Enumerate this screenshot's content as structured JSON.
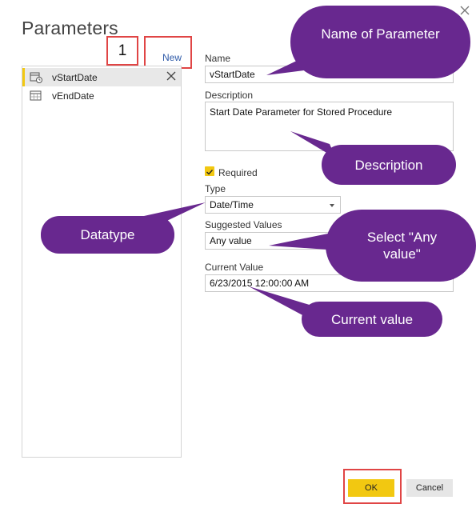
{
  "dialog": {
    "title": "Parameters",
    "new_link": "New",
    "badge": "1"
  },
  "parameters_list": [
    {
      "label": "vStartDate",
      "icon": "date-time-icon",
      "selected": true
    },
    {
      "label": "vEndDate",
      "icon": "calendar-grid-icon",
      "selected": false
    }
  ],
  "form": {
    "name_label": "Name",
    "name_value": "vStartDate",
    "description_label": "Description",
    "description_value": "Start Date Parameter for Stored Procedure",
    "required_label": "Required",
    "required_checked": true,
    "type_label": "Type",
    "type_value": "Date/Time",
    "suggested_label": "Suggested Values",
    "suggested_value": "Any value",
    "current_label": "Current Value",
    "current_value": "6/23/2015 12:00:00 AM"
  },
  "buttons": {
    "ok": "OK",
    "cancel": "Cancel"
  },
  "callouts": {
    "name": "Name of Parameter",
    "description": "Description",
    "datatype": "Datatype",
    "select_any": "Select \"Any value\"",
    "current": "Current value"
  },
  "colors": {
    "accent_yellow": "#f2c811",
    "callout_purple": "#68288f",
    "highlight_red": "#e04545",
    "link_blue": "#2e5aa8"
  }
}
